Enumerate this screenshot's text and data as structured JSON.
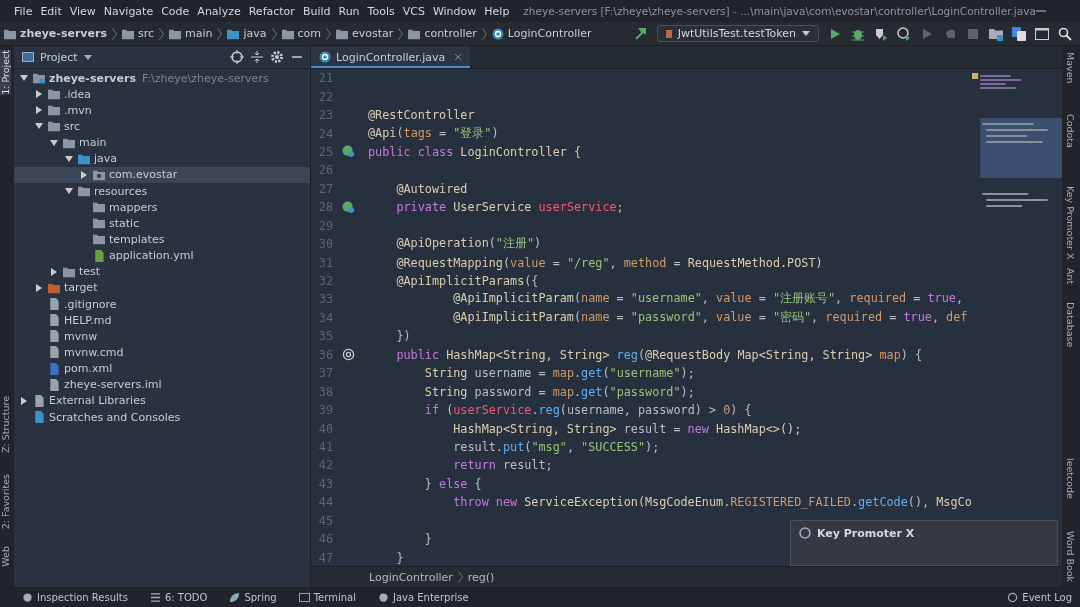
{
  "window": {
    "title": "zheye-servers [F:\\zheye\\zheye-servers] - ...\\main\\java\\com\\evostar\\controller\\LoginController.java"
  },
  "menu": [
    "File",
    "Edit",
    "View",
    "Navigate",
    "Code",
    "Analyze",
    "Refactor",
    "Build",
    "Run",
    "Tools",
    "VCS",
    "Window",
    "Help"
  ],
  "breadcrumbs": [
    {
      "label": "zheye-servers",
      "kind": "module"
    },
    {
      "label": "src",
      "kind": "folder"
    },
    {
      "label": "main",
      "kind": "folder"
    },
    {
      "label": "java",
      "kind": "source"
    },
    {
      "label": "com",
      "kind": "package"
    },
    {
      "label": "evostar",
      "kind": "package"
    },
    {
      "label": "controller",
      "kind": "package"
    },
    {
      "label": "LoginController",
      "kind": "class"
    }
  ],
  "run_config": "JwtUtilsTest.testToken",
  "left_stripe": [
    {
      "label": "1: Project",
      "selected": true
    },
    {
      "label": "Z: Structure",
      "selected": false
    },
    {
      "label": "2: Favorites",
      "selected": false
    },
    {
      "label": "Web",
      "selected": false
    }
  ],
  "project_panel": {
    "title": "Project",
    "tree": [
      {
        "label": "zheye-servers",
        "path": "F:\\zheye\\zheye-servers",
        "kind": "module",
        "expanded": true,
        "selected": false,
        "children": [
          {
            "label": ".idea",
            "kind": "folder",
            "expanded": false,
            "selected": false
          },
          {
            "label": ".mvn",
            "kind": "folder",
            "expanded": false,
            "selected": false
          },
          {
            "label": "src",
            "kind": "folder",
            "expanded": true,
            "selected": false,
            "children": [
              {
                "label": "main",
                "kind": "folder",
                "expanded": true,
                "selected": false,
                "children": [
                  {
                    "label": "java",
                    "kind": "source",
                    "expanded": true,
                    "selected": false,
                    "children": [
                      {
                        "label": "com.evostar",
                        "kind": "package",
                        "expanded": false,
                        "selected": true
                      }
                    ]
                  },
                  {
                    "label": "resources",
                    "kind": "resources",
                    "expanded": true,
                    "selected": false,
                    "children": [
                      {
                        "label": "mappers",
                        "kind": "folder",
                        "selected": false
                      },
                      {
                        "label": "static",
                        "kind": "folder",
                        "selected": false
                      },
                      {
                        "label": "templates",
                        "kind": "folder",
                        "selected": false
                      },
                      {
                        "label": "application.yml",
                        "kind": "yml",
                        "selected": false
                      }
                    ]
                  }
                ]
              },
              {
                "label": "test",
                "kind": "folder",
                "expanded": false,
                "selected": false
              }
            ]
          },
          {
            "label": "target",
            "kind": "excluded",
            "expanded": false,
            "selected": false
          },
          {
            "label": ".gitignore",
            "kind": "file",
            "selected": false
          },
          {
            "label": "HELP.md",
            "kind": "file",
            "selected": false
          },
          {
            "label": "mvnw",
            "kind": "script",
            "selected": false
          },
          {
            "label": "mvnw.cmd",
            "kind": "file",
            "selected": false
          },
          {
            "label": "pom.xml",
            "kind": "maven",
            "selected": false
          },
          {
            "label": "zheye-servers.iml",
            "kind": "file",
            "selected": false
          }
        ]
      },
      {
        "label": "External Libraries",
        "kind": "libraries",
        "expanded": false,
        "selected": false
      },
      {
        "label": "Scratches and Consoles",
        "kind": "scratches",
        "selected": false
      }
    ]
  },
  "editor": {
    "tabs": [
      {
        "label": "LoginController.java",
        "selected": true
      }
    ],
    "lines": [
      {
        "number": "21"
      },
      {
        "number": "22"
      },
      {
        "number": "23",
        "tokens": [
          {
            "text": "@RestController",
            "kind": "annotation"
          }
        ]
      },
      {
        "number": "24",
        "tokens": [
          {
            "text": "@Api",
            "kind": "annotation"
          },
          {
            "text": "(",
            "kind": "plain"
          },
          {
            "text": "tags",
            "kind": "param"
          },
          {
            "text": " = ",
            "kind": "plain"
          },
          {
            "text": "\"登录\"",
            "kind": "string"
          },
          {
            "text": ")",
            "kind": "plain"
          }
        ]
      },
      {
        "number": "25",
        "gutter": {
          "kind": "bean"
        },
        "tokens": [
          {
            "text": "public class ",
            "kind": "keyword"
          },
          {
            "text": "LoginController",
            "kind": "annotation"
          },
          {
            "text": " {",
            "kind": "type"
          }
        ]
      },
      {
        "number": "26"
      },
      {
        "number": "27",
        "tokens": [
          {
            "text": "    @Autowired",
            "kind": "annotation"
          }
        ]
      },
      {
        "number": "28",
        "gutter": {
          "kind": "bean"
        },
        "tokens": [
          {
            "text": "    private ",
            "kind": "keyword"
          },
          {
            "text": "UserService ",
            "kind": "annotation"
          },
          {
            "text": "userService",
            "kind": "field"
          },
          {
            "text": ";",
            "kind": "plain"
          }
        ]
      },
      {
        "number": "29"
      },
      {
        "number": "30",
        "tokens": [
          {
            "text": "    @ApiOperation",
            "kind": "annotation"
          },
          {
            "text": "(",
            "kind": "plain"
          },
          {
            "text": "\"注册\"",
            "kind": "string"
          },
          {
            "text": ")",
            "kind": "plain"
          }
        ]
      },
      {
        "number": "31",
        "tokens": [
          {
            "text": "    @RequestMapping",
            "kind": "annotation"
          },
          {
            "text": "(",
            "kind": "plain"
          },
          {
            "text": "value",
            "kind": "param"
          },
          {
            "text": " = ",
            "kind": "plain"
          },
          {
            "text": "\"/reg\"",
            "kind": "string"
          },
          {
            "text": ", ",
            "kind": "plain"
          },
          {
            "text": "method",
            "kind": "param"
          },
          {
            "text": " = ",
            "kind": "plain"
          },
          {
            "text": "RequestMethod.POST)",
            "kind": "annotation"
          }
        ]
      },
      {
        "number": "32",
        "tokens": [
          {
            "text": "    @ApiImplicitParams",
            "kind": "annotation"
          },
          {
            "text": "({",
            "kind": "plain"
          }
        ]
      },
      {
        "number": "33",
        "tokens": [
          {
            "text": "            @ApiImplicitParam",
            "kind": "annotation"
          },
          {
            "text": "(",
            "kind": "plain"
          },
          {
            "text": "name",
            "kind": "param"
          },
          {
            "text": " = ",
            "kind": "plain"
          },
          {
            "text": "\"username\"",
            "kind": "string"
          },
          {
            "text": ", ",
            "kind": "plain"
          },
          {
            "text": "value",
            "kind": "param"
          },
          {
            "text": " = ",
            "kind": "plain"
          },
          {
            "text": "\"注册账号\"",
            "kind": "string"
          },
          {
            "text": ", ",
            "kind": "plain"
          },
          {
            "text": "required",
            "kind": "param"
          },
          {
            "text": " = ",
            "kind": "plain"
          },
          {
            "text": "true",
            "kind": "keyword"
          },
          {
            "text": ",",
            "kind": "plain"
          }
        ]
      },
      {
        "number": "34",
        "tokens": [
          {
            "text": "            @ApiImplicitParam",
            "kind": "annotation"
          },
          {
            "text": "(",
            "kind": "plain"
          },
          {
            "text": "name",
            "kind": "param"
          },
          {
            "text": " = ",
            "kind": "plain"
          },
          {
            "text": "\"password\"",
            "kind": "string"
          },
          {
            "text": ", ",
            "kind": "plain"
          },
          {
            "text": "value",
            "kind": "param"
          },
          {
            "text": " = ",
            "kind": "plain"
          },
          {
            "text": "\"密码\"",
            "kind": "string"
          },
          {
            "text": ", ",
            "kind": "plain"
          },
          {
            "text": "required",
            "kind": "param"
          },
          {
            "text": " = ",
            "kind": "plain"
          },
          {
            "text": "true",
            "kind": "keyword"
          },
          {
            "text": ", ",
            "kind": "plain"
          },
          {
            "text": "def",
            "kind": "param"
          }
        ]
      },
      {
        "number": "35",
        "tokens": [
          {
            "text": "    })",
            "kind": "plain"
          }
        ]
      },
      {
        "number": "36",
        "gutter": {
          "kind": "at"
        },
        "tokens": [
          {
            "text": "    public ",
            "kind": "keyword"
          },
          {
            "text": "HashMap<String, String> ",
            "kind": "annotation"
          },
          {
            "text": "reg",
            "kind": "method"
          },
          {
            "text": "(",
            "kind": "plain"
          },
          {
            "text": "@RequestBody ",
            "kind": "annotation"
          },
          {
            "text": "Map<String, String> ",
            "kind": "annotation"
          },
          {
            "text": "map",
            "kind": "param"
          },
          {
            "text": ") {",
            "kind": "plain"
          }
        ]
      },
      {
        "number": "37",
        "tokens": [
          {
            "text": "        String ",
            "kind": "annotation"
          },
          {
            "text": "username = ",
            "kind": "plain"
          },
          {
            "text": "map",
            "kind": "param"
          },
          {
            "text": ".",
            "kind": "plain"
          },
          {
            "text": "get",
            "kind": "method"
          },
          {
            "text": "(",
            "kind": "plain"
          },
          {
            "text": "\"username\"",
            "kind": "string"
          },
          {
            "text": ");",
            "kind": "plain"
          }
        ]
      },
      {
        "number": "38",
        "tokens": [
          {
            "text": "        String ",
            "kind": "annotation"
          },
          {
            "text": "password = ",
            "kind": "plain"
          },
          {
            "text": "map",
            "kind": "param"
          },
          {
            "text": ".",
            "kind": "plain"
          },
          {
            "text": "get",
            "kind": "method"
          },
          {
            "text": "(",
            "kind": "plain"
          },
          {
            "text": "\"password\"",
            "kind": "string"
          },
          {
            "text": ");",
            "kind": "plain"
          }
        ]
      },
      {
        "number": "39",
        "tokens": [
          {
            "text": "        if ",
            "kind": "keyword"
          },
          {
            "text": "(",
            "kind": "plain"
          },
          {
            "text": "userService",
            "kind": "field"
          },
          {
            "text": ".",
            "kind": "plain"
          },
          {
            "text": "reg",
            "kind": "method"
          },
          {
            "text": "(username, password) > ",
            "kind": "plain"
          },
          {
            "text": "0",
            "kind": "param"
          },
          {
            "text": ") {",
            "kind": "plain"
          }
        ]
      },
      {
        "number": "40",
        "tokens": [
          {
            "text": "            HashMap<String, String> ",
            "kind": "annotation"
          },
          {
            "text": "result = ",
            "kind": "plain"
          },
          {
            "text": "new ",
            "kind": "keyword"
          },
          {
            "text": "HashMap<>();",
            "kind": "annotation"
          }
        ]
      },
      {
        "number": "41",
        "tokens": [
          {
            "text": "            result.",
            "kind": "plain"
          },
          {
            "text": "put",
            "kind": "method"
          },
          {
            "text": "(",
            "kind": "plain"
          },
          {
            "text": "\"msg\"",
            "kind": "string"
          },
          {
            "text": ", ",
            "kind": "plain"
          },
          {
            "text": "\"SUCCESS\"",
            "kind": "string"
          },
          {
            "text": ");",
            "kind": "plain"
          }
        ]
      },
      {
        "number": "42",
        "tokens": [
          {
            "text": "            return ",
            "kind": "keyword"
          },
          {
            "text": "result;",
            "kind": "plain"
          }
        ]
      },
      {
        "number": "43",
        "tokens": [
          {
            "text": "        } ",
            "kind": "plain"
          },
          {
            "text": "else ",
            "kind": "keyword"
          },
          {
            "text": "{",
            "kind": "plain"
          }
        ]
      },
      {
        "number": "44",
        "tokens": [
          {
            "text": "            throw new ",
            "kind": "keyword"
          },
          {
            "text": "ServiceException(MsgCodeEnum.",
            "kind": "annotation"
          },
          {
            "text": "REGISTERED_FAILED",
            "kind": "param"
          },
          {
            "text": ".",
            "kind": "plain"
          },
          {
            "text": "getCode",
            "kind": "method"
          },
          {
            "text": "(), ",
            "kind": "plain"
          },
          {
            "text": "MsgCo",
            "kind": "annotation"
          }
        ]
      },
      {
        "number": "45"
      },
      {
        "number": "46",
        "tokens": [
          {
            "text": "        }",
            "kind": "plain"
          }
        ]
      },
      {
        "number": "47",
        "tokens": [
          {
            "text": "    }",
            "kind": "plain"
          }
        ]
      }
    ],
    "breadcrumbs": [
      "LoginController",
      "reg()"
    ]
  },
  "right_stripe": [
    "Maven",
    "Codota",
    "Key Promoter X",
    "Ant",
    "Database",
    "leetcode",
    "Word Book"
  ],
  "notification": {
    "title": "Key Promoter X"
  },
  "bottom_bar": {
    "tools": [
      {
        "label": "Inspection Results",
        "kind": "inspect"
      },
      {
        "label": "6: TODO",
        "kind": "todo"
      },
      {
        "label": "Spring",
        "kind": "spring"
      },
      {
        "label": "Terminal",
        "kind": "terminal"
      },
      {
        "label": "Java Enterprise",
        "kind": "enterprise"
      }
    ],
    "event_log": "Event Log"
  }
}
